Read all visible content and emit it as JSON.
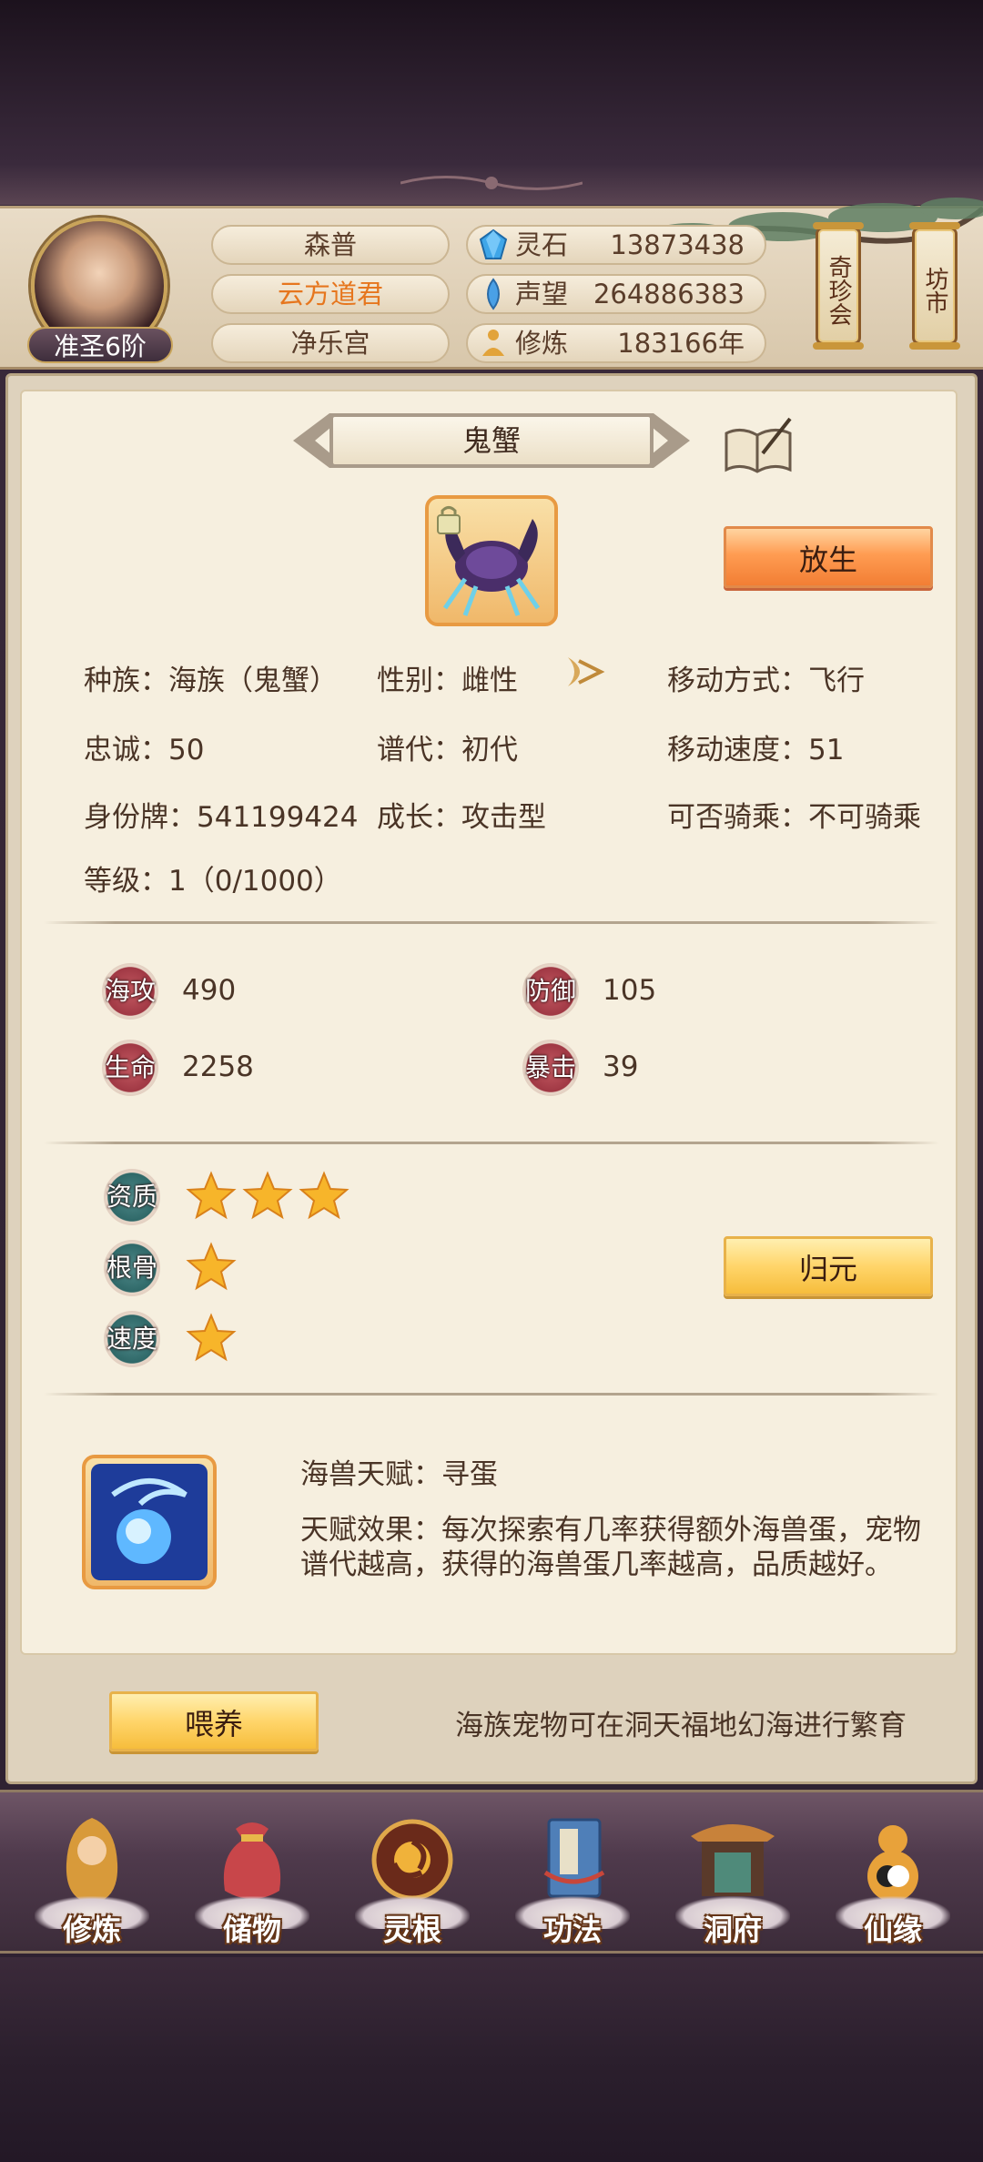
{
  "header": {
    "rank": "准圣6阶",
    "names": [
      "森普",
      "云方道君",
      "净乐宫"
    ],
    "resources": [
      {
        "label": "灵石",
        "value": "13873438",
        "icon": "spirit-stone-icon"
      },
      {
        "label": "声望",
        "value": "264886383",
        "icon": "prestige-icon"
      },
      {
        "label": "修炼",
        "value": "183166年",
        "icon": "meditation-icon"
      }
    ],
    "shops": [
      "奇珍会",
      "坊市"
    ],
    "colors": {
      "guild_name": "#e6761e"
    }
  },
  "pet": {
    "name": "鬼蟹",
    "release_label": "放生",
    "info": {
      "race": "种族：海族（鬼蟹）",
      "gender": "性别：雌性",
      "move_type": "移动方式：飞行",
      "loyalty": "忠诚：50",
      "generation": "谱代：初代",
      "move_speed": "移动速度：51",
      "id_tag": "身份牌：541199424",
      "growth": "成长：攻击型",
      "rideable": "可否骑乘：不可骑乘",
      "level": "等级：1（0/1000）"
    },
    "stats": [
      {
        "label": "海攻",
        "value": "490"
      },
      {
        "label": "防御",
        "value": "105"
      },
      {
        "label": "生命",
        "value": "2258"
      },
      {
        "label": "暴击",
        "value": "39"
      }
    ],
    "qualities": [
      {
        "label": "资质",
        "stars": 3
      },
      {
        "label": "根骨",
        "stars": 1
      },
      {
        "label": "速度",
        "stars": 1
      }
    ],
    "reset_label": "归元",
    "talent": {
      "title": "海兽天赋：寻蛋",
      "desc": "天赋效果：每次探索有几率获得额外海兽蛋，宠物谱代越高，获得的海兽蛋几率越高，品质越好。"
    },
    "feed_label": "喂养",
    "tip": "海族宠物可在洞天福地幻海进行繁育"
  },
  "nav": {
    "items": [
      {
        "label": "修炼",
        "icon": "cultivation-icon"
      },
      {
        "label": "储物",
        "icon": "storage-bag-icon"
      },
      {
        "label": "灵根",
        "icon": "spirit-root-icon"
      },
      {
        "label": "功法",
        "icon": "technique-book-icon"
      },
      {
        "label": "洞府",
        "icon": "cave-mansion-icon"
      },
      {
        "label": "仙缘",
        "icon": "immortal-fate-icon"
      }
    ]
  }
}
